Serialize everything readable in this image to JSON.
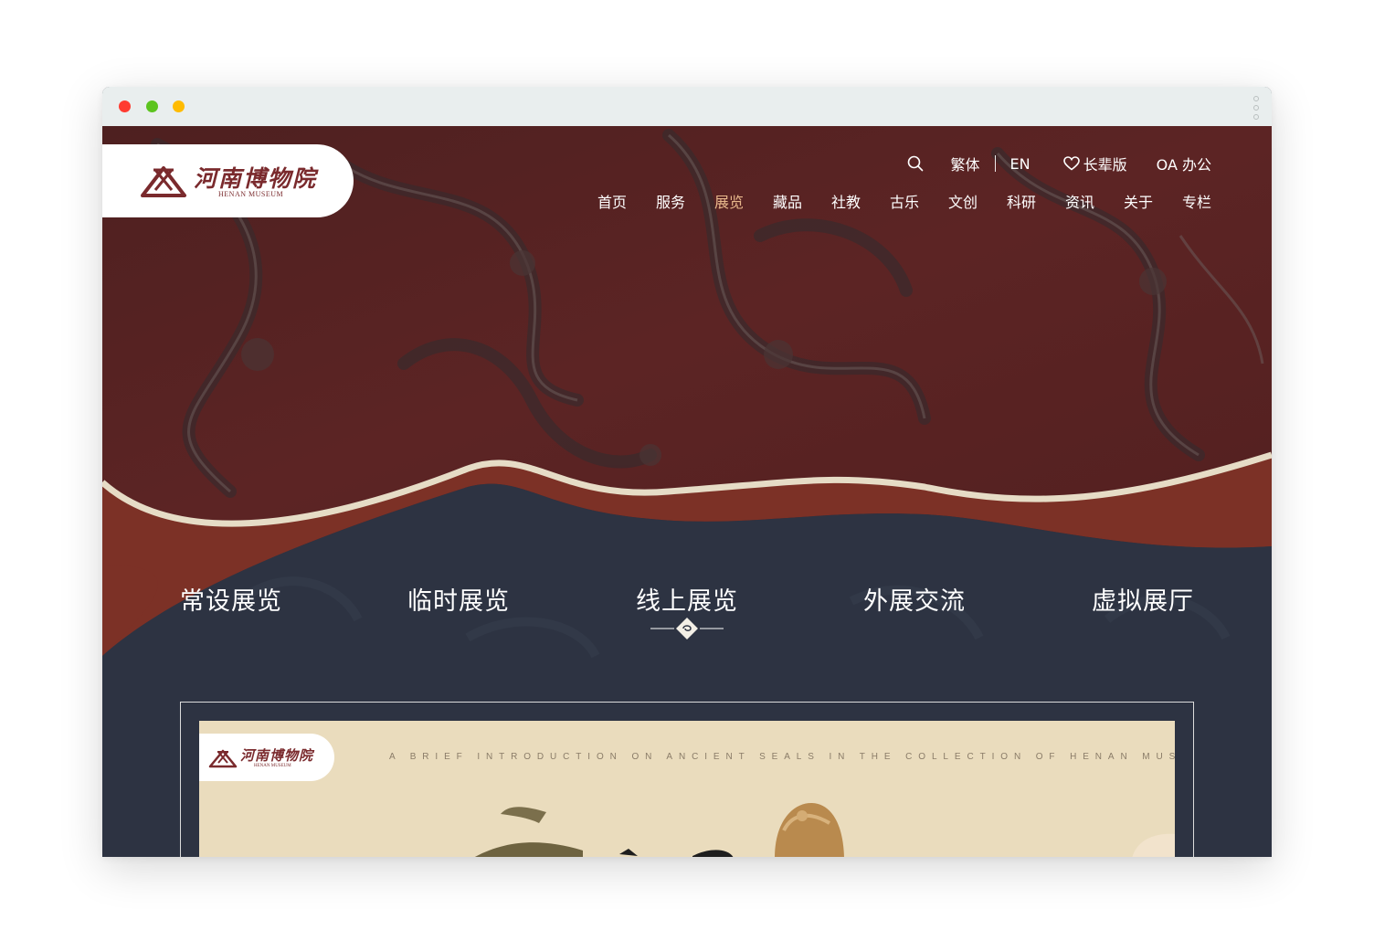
{
  "browser": {
    "menu_icon": "vertical-dots-icon"
  },
  "logo": {
    "cn": "河南博物院",
    "en": "HENAN MUSEUM"
  },
  "utility": {
    "search_icon": "search-icon",
    "traditional": "繁体",
    "english": "EN",
    "elder_icon": "heart-icon",
    "elder": "长辈版",
    "oa": "OA 办公"
  },
  "nav": {
    "items": [
      {
        "label": "首页"
      },
      {
        "label": "服务"
      },
      {
        "label": "展览"
      },
      {
        "label": "藏品"
      },
      {
        "label": "社教"
      },
      {
        "label": "古乐"
      },
      {
        "label": "文创"
      },
      {
        "label": "科研"
      },
      {
        "label": "资讯"
      },
      {
        "label": "关于"
      },
      {
        "label": "专栏"
      }
    ],
    "active": "展览"
  },
  "categories": {
    "items": [
      {
        "label": "常设展览"
      },
      {
        "label": "临时展览"
      },
      {
        "label": "线上展览"
      },
      {
        "label": "外展交流"
      },
      {
        "label": "虚拟展厅"
      }
    ],
    "active": "线上展览"
  },
  "banner": {
    "logo_cn": "河南博物院",
    "logo_en": "HENAN MUSEUM",
    "tagline": "A BRIEF INTRODUCTION ON ANCIENT SEALS IN THE COLLECTION OF HENAN MUSEUM"
  },
  "colors": {
    "brand": "#7a2a2d",
    "hero_red": "#5a2323",
    "rust_band": "#7c3126",
    "navy": "#2d3342",
    "active_nav": "#e8b88c",
    "banner_bg": "#eadcbd"
  }
}
